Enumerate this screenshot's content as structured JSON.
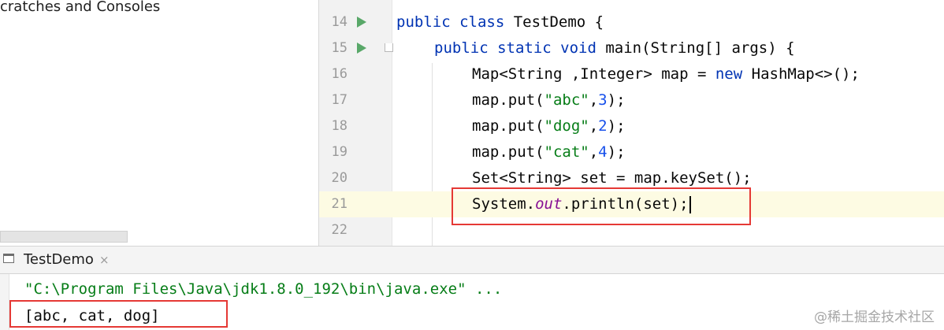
{
  "project_panel": {
    "item_label": "cratches and Consoles"
  },
  "editor": {
    "lines": [
      {
        "num": "14"
      },
      {
        "num": "15"
      },
      {
        "num": "16"
      },
      {
        "num": "17"
      },
      {
        "num": "18"
      },
      {
        "num": "19"
      },
      {
        "num": "20"
      },
      {
        "num": "21"
      },
      {
        "num": "22"
      }
    ],
    "code": {
      "l14_kw": "public class",
      "l14_rest": " TestDemo {",
      "l15_kw": "public static void",
      "l15_rest": " main(String[] args) {",
      "l16_a": "Map<String ,Integer> map = ",
      "l16_kw": "new",
      "l16_b": " HashMap<>();",
      "l17_a": "map.put(",
      "l17_str": "\"abc\"",
      "l17_b": ",",
      "l17_num": "3",
      "l17_c": ");",
      "l18_a": "map.put(",
      "l18_str": "\"dog\"",
      "l18_b": ",",
      "l18_num": "2",
      "l18_c": ");",
      "l19_a": "map.put(",
      "l19_str": "\"cat\"",
      "l19_b": ",",
      "l19_num": "4",
      "l19_c": ");",
      "l20": "Set<String> set = map.keySet();",
      "l21_a": "System.",
      "l21_field": "out",
      "l21_b": ".println(set);"
    }
  },
  "run_panel": {
    "tab_label": "TestDemo",
    "tab_close": "×",
    "command_line": "\"C:\\Program Files\\Java\\jdk1.8.0_192\\bin\\java.exe\" ...",
    "output_line": "[abc, cat, dog]"
  },
  "watermark": "@稀土掘金技术社区",
  "colors": {
    "keyword": "#0033b3",
    "string": "#067d17",
    "number": "#1750eb",
    "static_field": "#871094",
    "run_icon": "#59a869",
    "highlight_box": "#e53935",
    "current_line": "#fdfbe3"
  },
  "icons": [
    "run-gutter-icon",
    "fold-icon",
    "console-tab-icon",
    "close-icon"
  ]
}
